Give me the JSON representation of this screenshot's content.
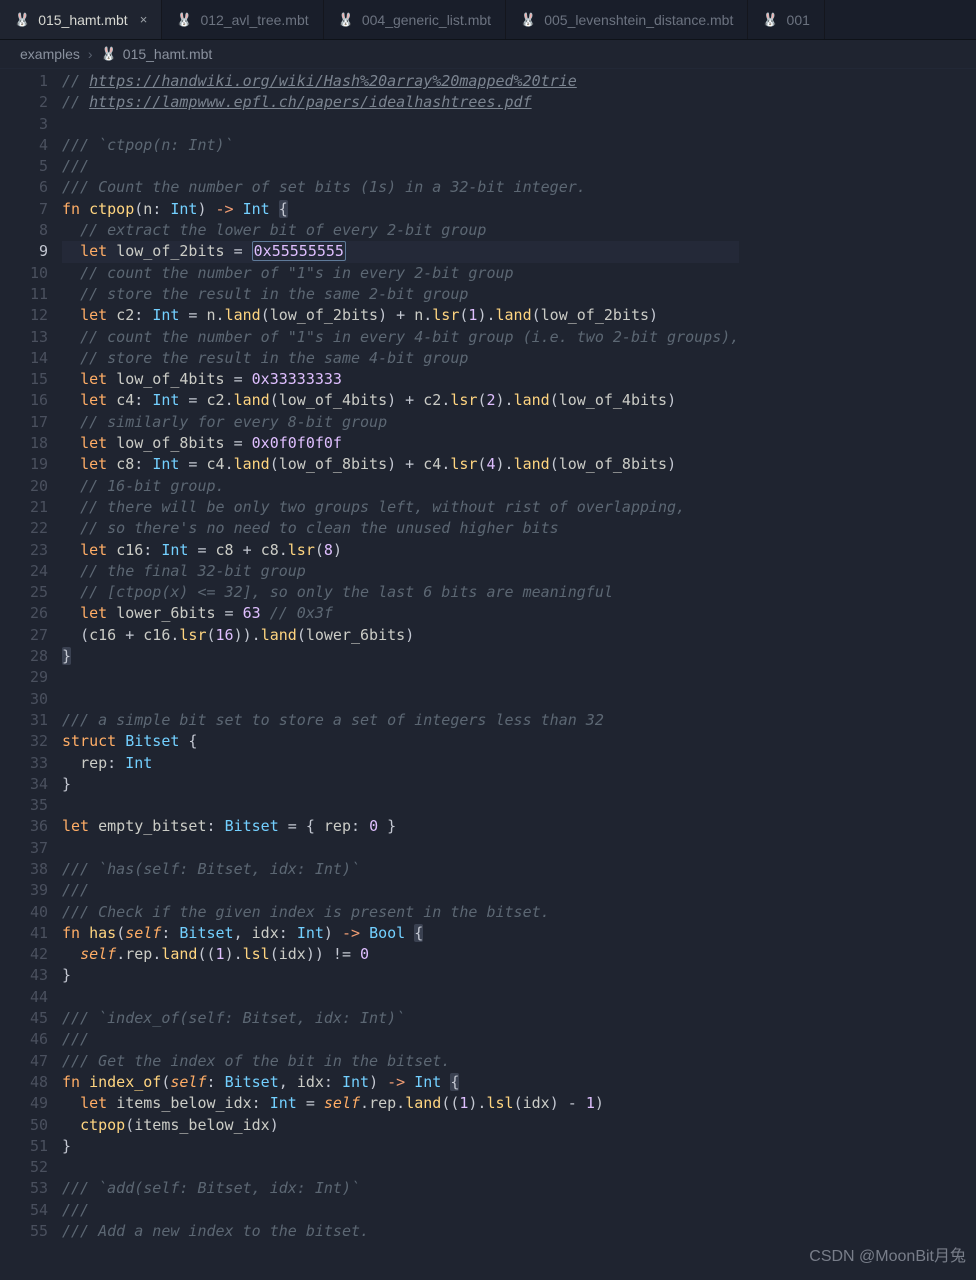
{
  "tabs": [
    {
      "icon": "🐰",
      "label": "015_hamt.mbt",
      "active": true,
      "close": "×"
    },
    {
      "icon": "🐰",
      "label": "012_avl_tree.mbt",
      "active": false
    },
    {
      "icon": "🐰",
      "label": "004_generic_list.mbt",
      "active": false
    },
    {
      "icon": "🐰",
      "label": "005_levenshtein_distance.mbt",
      "active": false
    },
    {
      "icon": "🐰",
      "label": "001",
      "active": false,
      "truncated": true
    }
  ],
  "breadcrumbs": {
    "root": "examples",
    "sep": "›",
    "file_icon": "🐰",
    "file": "015_hamt.mbt"
  },
  "editor": {
    "first_line": 1,
    "current_line": 9,
    "selection_text": "0x55555555"
  },
  "lines": [
    {
      "n": 1,
      "t": "comment_link",
      "pre": "// ",
      "link": "https://handwiki.org/wiki/Hash%20array%20mapped%20trie"
    },
    {
      "n": 2,
      "t": "comment_link",
      "pre": "// ",
      "link": "https://lampwww.epfl.ch/papers/idealhashtrees.pdf"
    },
    {
      "n": 3,
      "t": "blank"
    },
    {
      "n": 4,
      "t": "comment",
      "text": "/// `ctpop(n: Int)`"
    },
    {
      "n": 5,
      "t": "comment",
      "text": "///"
    },
    {
      "n": 6,
      "t": "comment",
      "text": "/// Count the number of set bits (1s) in a 32-bit integer."
    },
    {
      "n": 7,
      "t": "fn_sig",
      "kw": "fn",
      "name": "ctpop",
      "params": [
        [
          "n",
          "Int"
        ]
      ],
      "ret": "Int",
      "open": "{"
    },
    {
      "n": 8,
      "t": "comment_i",
      "text": "// extract the lower bit of every 2-bit group"
    },
    {
      "n": 9,
      "t": "let_sel",
      "kw": "let",
      "name": "low_of_2bits",
      "eq": " = ",
      "val": "0x55555555"
    },
    {
      "n": 10,
      "t": "comment_i",
      "text": "// count the number of \"1\"s in every 2-bit group"
    },
    {
      "n": 11,
      "t": "comment_i",
      "text": "// store the result in the same 2-bit group"
    },
    {
      "n": 12,
      "t": "code",
      "segs": [
        [
          "kw",
          "let"
        ],
        [
          "sp",
          " "
        ],
        [
          "var",
          "c2"
        ],
        [
          "pr",
          ": "
        ],
        [
          "ty",
          "Int"
        ],
        [
          "pr",
          " = "
        ],
        [
          "var",
          "n"
        ],
        [
          "pr",
          "."
        ],
        [
          "fn",
          "land"
        ],
        [
          "pr",
          "("
        ],
        [
          "var",
          "low_of_2bits"
        ],
        [
          "pr",
          ") + "
        ],
        [
          "var",
          "n"
        ],
        [
          "pr",
          "."
        ],
        [
          "fn",
          "lsr"
        ],
        [
          "pr",
          "("
        ],
        [
          "num",
          "1"
        ],
        [
          "pr",
          ")."
        ],
        [
          "fn",
          "land"
        ],
        [
          "pr",
          "("
        ],
        [
          "var",
          "low_of_2bits"
        ],
        [
          "pr",
          ")"
        ]
      ]
    },
    {
      "n": 13,
      "t": "comment_i",
      "text": "// count the number of \"1\"s in every 4-bit group (i.e. two 2-bit groups),"
    },
    {
      "n": 14,
      "t": "comment_i",
      "text": "// store the result in the same 4-bit group"
    },
    {
      "n": 15,
      "t": "code",
      "segs": [
        [
          "kw",
          "let"
        ],
        [
          "sp",
          " "
        ],
        [
          "var",
          "low_of_4bits"
        ],
        [
          "pr",
          " = "
        ],
        [
          "num",
          "0x33333333"
        ]
      ]
    },
    {
      "n": 16,
      "t": "code",
      "segs": [
        [
          "kw",
          "let"
        ],
        [
          "sp",
          " "
        ],
        [
          "var",
          "c4"
        ],
        [
          "pr",
          ": "
        ],
        [
          "ty",
          "Int"
        ],
        [
          "pr",
          " = "
        ],
        [
          "var",
          "c2"
        ],
        [
          "pr",
          "."
        ],
        [
          "fn",
          "land"
        ],
        [
          "pr",
          "("
        ],
        [
          "var",
          "low_of_4bits"
        ],
        [
          "pr",
          ") + "
        ],
        [
          "var",
          "c2"
        ],
        [
          "pr",
          "."
        ],
        [
          "fn",
          "lsr"
        ],
        [
          "pr",
          "("
        ],
        [
          "num",
          "2"
        ],
        [
          "pr",
          ")."
        ],
        [
          "fn",
          "land"
        ],
        [
          "pr",
          "("
        ],
        [
          "var",
          "low_of_4bits"
        ],
        [
          "pr",
          ")"
        ]
      ]
    },
    {
      "n": 17,
      "t": "comment_i",
      "text": "// similarly for every 8-bit group"
    },
    {
      "n": 18,
      "t": "code",
      "segs": [
        [
          "kw",
          "let"
        ],
        [
          "sp",
          " "
        ],
        [
          "var",
          "low_of_8bits"
        ],
        [
          "pr",
          " = "
        ],
        [
          "num",
          "0x0f0f0f0f"
        ]
      ]
    },
    {
      "n": 19,
      "t": "code",
      "segs": [
        [
          "kw",
          "let"
        ],
        [
          "sp",
          " "
        ],
        [
          "var",
          "c8"
        ],
        [
          "pr",
          ": "
        ],
        [
          "ty",
          "Int"
        ],
        [
          "pr",
          " = "
        ],
        [
          "var",
          "c4"
        ],
        [
          "pr",
          "."
        ],
        [
          "fn",
          "land"
        ],
        [
          "pr",
          "("
        ],
        [
          "var",
          "low_of_8bits"
        ],
        [
          "pr",
          ") + "
        ],
        [
          "var",
          "c4"
        ],
        [
          "pr",
          "."
        ],
        [
          "fn",
          "lsr"
        ],
        [
          "pr",
          "("
        ],
        [
          "num",
          "4"
        ],
        [
          "pr",
          ")."
        ],
        [
          "fn",
          "land"
        ],
        [
          "pr",
          "("
        ],
        [
          "var",
          "low_of_8bits"
        ],
        [
          "pr",
          ")"
        ]
      ]
    },
    {
      "n": 20,
      "t": "comment_i",
      "text": "// 16-bit group."
    },
    {
      "n": 21,
      "t": "comment_i",
      "text": "// there will be only two groups left, without rist of overlapping,"
    },
    {
      "n": 22,
      "t": "comment_i",
      "text": "// so there's no need to clean the unused higher bits"
    },
    {
      "n": 23,
      "t": "code",
      "segs": [
        [
          "kw",
          "let"
        ],
        [
          "sp",
          " "
        ],
        [
          "var",
          "c16"
        ],
        [
          "pr",
          ": "
        ],
        [
          "ty",
          "Int"
        ],
        [
          "pr",
          " = "
        ],
        [
          "var",
          "c8"
        ],
        [
          "pr",
          " + "
        ],
        [
          "var",
          "c8"
        ],
        [
          "pr",
          "."
        ],
        [
          "fn",
          "lsr"
        ],
        [
          "pr",
          "("
        ],
        [
          "num",
          "8"
        ],
        [
          "pr",
          ")"
        ]
      ]
    },
    {
      "n": 24,
      "t": "comment_i",
      "text": "// the final 32-bit group"
    },
    {
      "n": 25,
      "t": "comment_i",
      "text": "// [ctpop(x) <= 32], so only the last 6 bits are meaningful"
    },
    {
      "n": 26,
      "t": "code",
      "segs": [
        [
          "kw",
          "let"
        ],
        [
          "sp",
          " "
        ],
        [
          "var",
          "lower_6bits"
        ],
        [
          "pr",
          " = "
        ],
        [
          "num",
          "63"
        ],
        [
          "sp",
          " "
        ],
        [
          "cm",
          "// 0x3f"
        ]
      ]
    },
    {
      "n": 27,
      "t": "code",
      "segs": [
        [
          "pr",
          "("
        ],
        [
          "var",
          "c16"
        ],
        [
          "pr",
          " + "
        ],
        [
          "var",
          "c16"
        ],
        [
          "pr",
          "."
        ],
        [
          "fn",
          "lsr"
        ],
        [
          "pr",
          "("
        ],
        [
          "num",
          "16"
        ],
        [
          "pr",
          "))."
        ],
        [
          "fn",
          "land"
        ],
        [
          "pr",
          "("
        ],
        [
          "var",
          "lower_6bits"
        ],
        [
          "pr",
          ")"
        ]
      ]
    },
    {
      "n": 28,
      "t": "close_brace"
    },
    {
      "n": 29,
      "t": "blank"
    },
    {
      "n": 30,
      "t": "blank"
    },
    {
      "n": 31,
      "t": "comment",
      "text": "/// a simple bit set to store a set of integers less than 32"
    },
    {
      "n": 32,
      "t": "code0",
      "segs": [
        [
          "kw",
          "struct"
        ],
        [
          "sp",
          " "
        ],
        [
          "ty",
          "Bitset"
        ],
        [
          "pr",
          " {"
        ]
      ]
    },
    {
      "n": 33,
      "t": "code",
      "segs": [
        [
          "var",
          "rep"
        ],
        [
          "pr",
          ": "
        ],
        [
          "ty",
          "Int"
        ]
      ]
    },
    {
      "n": 34,
      "t": "code0",
      "segs": [
        [
          "pr",
          "}"
        ]
      ]
    },
    {
      "n": 35,
      "t": "blank"
    },
    {
      "n": 36,
      "t": "code0",
      "segs": [
        [
          "kw",
          "let"
        ],
        [
          "sp",
          " "
        ],
        [
          "var",
          "empty_bitset"
        ],
        [
          "pr",
          ": "
        ],
        [
          "ty",
          "Bitset"
        ],
        [
          "pr",
          " = { "
        ],
        [
          "var",
          "rep"
        ],
        [
          "pr",
          ": "
        ],
        [
          "num",
          "0"
        ],
        [
          "pr",
          " }"
        ]
      ]
    },
    {
      "n": 37,
      "t": "blank"
    },
    {
      "n": 38,
      "t": "comment",
      "text": "/// `has(self: Bitset, idx: Int)`"
    },
    {
      "n": 39,
      "t": "comment",
      "text": "///"
    },
    {
      "n": 40,
      "t": "comment",
      "text": "/// Check if the given index is present in the bitset."
    },
    {
      "n": 41,
      "t": "fn_sig",
      "kw": "fn",
      "name": "has",
      "params": [
        [
          "self",
          "Bitset"
        ],
        [
          "idx",
          "Int"
        ]
      ],
      "ret": "Bool",
      "open": "{"
    },
    {
      "n": 42,
      "t": "code",
      "segs": [
        [
          "self",
          "self"
        ],
        [
          "pr",
          "."
        ],
        [
          "var",
          "rep"
        ],
        [
          "pr",
          "."
        ],
        [
          "fn",
          "land"
        ],
        [
          "pr",
          "(("
        ],
        [
          "num",
          "1"
        ],
        [
          "pr",
          ")."
        ],
        [
          "fn",
          "lsl"
        ],
        [
          "pr",
          "("
        ],
        [
          "var",
          "idx"
        ],
        [
          "pr",
          ")) != "
        ],
        [
          "num",
          "0"
        ]
      ]
    },
    {
      "n": 43,
      "t": "code0",
      "segs": [
        [
          "pr",
          "}"
        ]
      ]
    },
    {
      "n": 44,
      "t": "blank"
    },
    {
      "n": 45,
      "t": "comment",
      "text": "/// `index_of(self: Bitset, idx: Int)`"
    },
    {
      "n": 46,
      "t": "comment",
      "text": "///"
    },
    {
      "n": 47,
      "t": "comment",
      "text": "/// Get the index of the bit in the bitset."
    },
    {
      "n": 48,
      "t": "fn_sig",
      "kw": "fn",
      "name": "index_of",
      "params": [
        [
          "self",
          "Bitset"
        ],
        [
          "idx",
          "Int"
        ]
      ],
      "ret": "Int",
      "open": "{"
    },
    {
      "n": 49,
      "t": "code",
      "segs": [
        [
          "kw",
          "let"
        ],
        [
          "sp",
          " "
        ],
        [
          "var",
          "items_below_idx"
        ],
        [
          "pr",
          ": "
        ],
        [
          "ty",
          "Int"
        ],
        [
          "pr",
          " = "
        ],
        [
          "self",
          "self"
        ],
        [
          "pr",
          "."
        ],
        [
          "var",
          "rep"
        ],
        [
          "pr",
          "."
        ],
        [
          "fn",
          "land"
        ],
        [
          "pr",
          "(("
        ],
        [
          "num",
          "1"
        ],
        [
          "pr",
          ")."
        ],
        [
          "fn",
          "lsl"
        ],
        [
          "pr",
          "("
        ],
        [
          "var",
          "idx"
        ],
        [
          "pr",
          ") - "
        ],
        [
          "num",
          "1"
        ],
        [
          "pr",
          ")"
        ]
      ]
    },
    {
      "n": 50,
      "t": "code",
      "segs": [
        [
          "fn",
          "ctpop"
        ],
        [
          "pr",
          "("
        ],
        [
          "var",
          "items_below_idx"
        ],
        [
          "pr",
          ")"
        ]
      ]
    },
    {
      "n": 51,
      "t": "code0",
      "segs": [
        [
          "pr",
          "}"
        ]
      ]
    },
    {
      "n": 52,
      "t": "blank"
    },
    {
      "n": 53,
      "t": "comment",
      "text": "/// `add(self: Bitset, idx: Int)`"
    },
    {
      "n": 54,
      "t": "comment",
      "text": "///"
    },
    {
      "n": 55,
      "t": "comment",
      "text": "/// Add a new index to the bitset."
    }
  ],
  "watermark": "CSDN @MoonBit月兔"
}
